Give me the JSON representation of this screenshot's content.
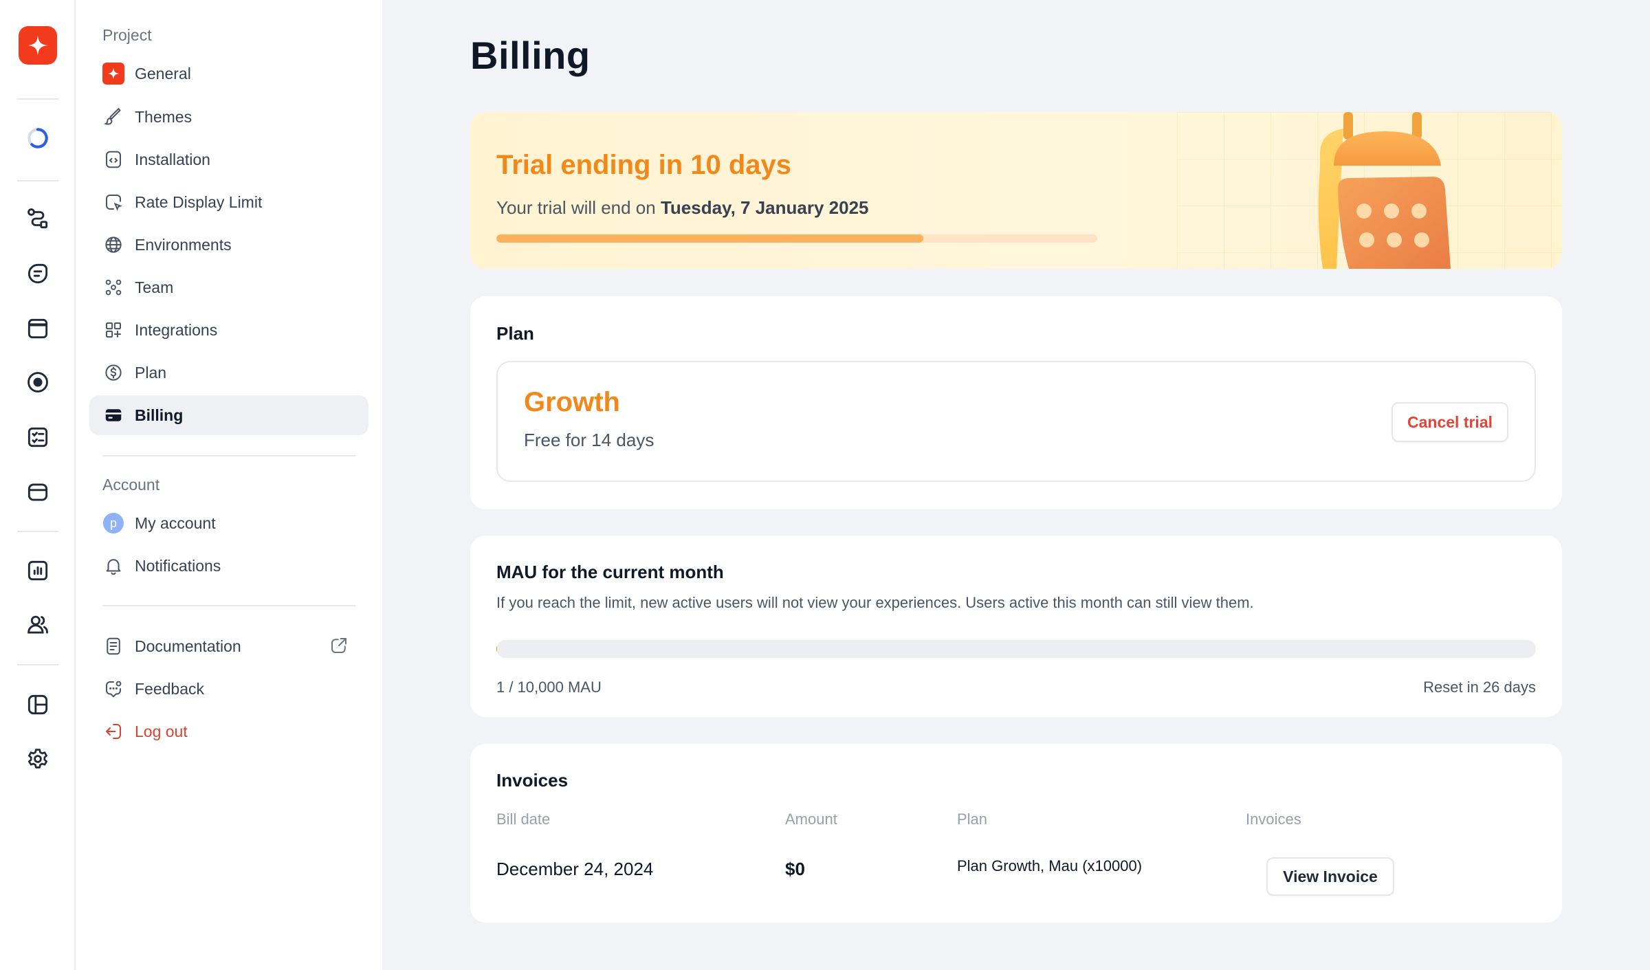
{
  "sidebar": {
    "project_title": "Project",
    "project_items": [
      {
        "label": "General"
      },
      {
        "label": "Themes"
      },
      {
        "label": "Installation"
      },
      {
        "label": "Rate Display Limit"
      },
      {
        "label": "Environments"
      },
      {
        "label": "Team"
      },
      {
        "label": "Integrations"
      },
      {
        "label": "Plan"
      },
      {
        "label": "Billing"
      }
    ],
    "account_title": "Account",
    "account_items": [
      {
        "label": "My account",
        "avatar": "p"
      },
      {
        "label": "Notifications"
      }
    ],
    "footer_items": [
      {
        "label": "Documentation"
      },
      {
        "label": "Feedback"
      },
      {
        "label": "Log out"
      }
    ]
  },
  "main": {
    "title": "Billing",
    "trial": {
      "title": "Trial ending in 10 days",
      "sub_prefix": "Your trial will end on ",
      "end_date": "Tuesday, 7 January 2025",
      "progress_fraction": 0.71
    },
    "plan": {
      "heading": "Plan",
      "name": "Growth",
      "desc": "Free for 14 days",
      "cancel_label": "Cancel trial"
    },
    "mau": {
      "heading": "MAU for the current month",
      "desc": "If you reach the limit, new active users will not view your experiences. Users active this month can still view them.",
      "usage": "1 / 10,000 MAU",
      "used_fraction": 0.0001,
      "reset": "Reset in 26 days"
    },
    "invoices": {
      "heading": "Invoices",
      "columns": [
        "Bill date",
        "Amount",
        "Plan",
        "Invoices"
      ],
      "rows": [
        {
          "date": "December 24, 2024",
          "amount": "$0",
          "plan": "Plan Growth, Mau (x10000)",
          "action": "View Invoice"
        }
      ]
    }
  },
  "colors": {
    "brand": "#f23b1d",
    "accent": "#f0891c",
    "danger": "#e0453a"
  }
}
